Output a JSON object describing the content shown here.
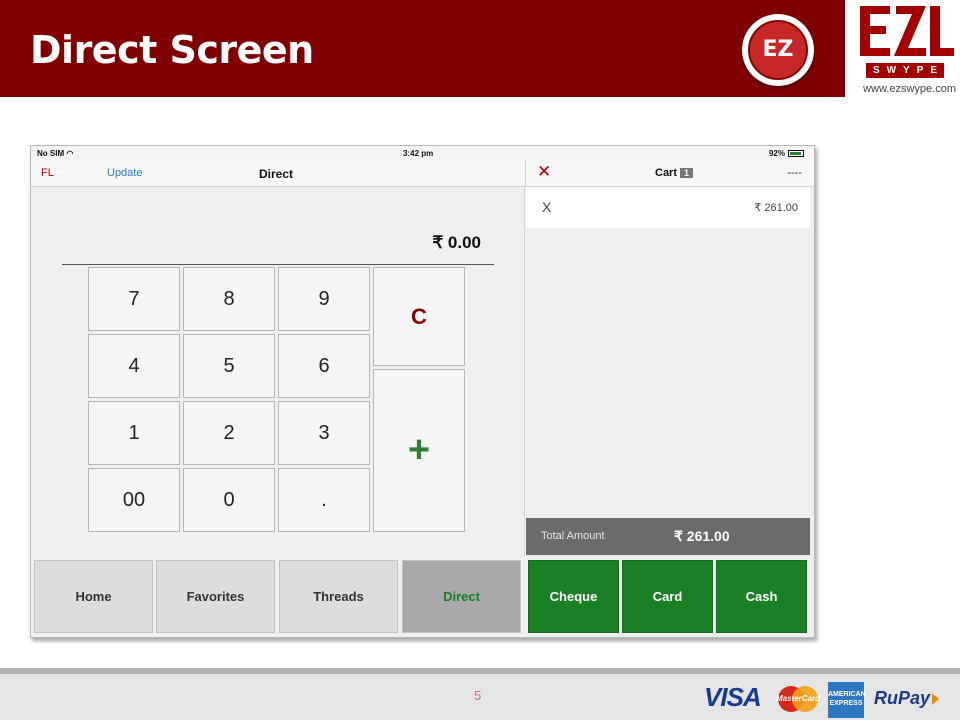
{
  "slide": {
    "title": "Direct Screen",
    "page_number": "5",
    "badge_text": "EZ"
  },
  "logo": {
    "swype": "SWYPE",
    "url": "www.ezswype.com"
  },
  "status_bar": {
    "carrier": "No SIM",
    "time": "3:42 pm",
    "battery": "92%"
  },
  "top_bar": {
    "fl": "FL",
    "update": "Update",
    "title": "Direct",
    "close_symbol": "✕",
    "cart_label": "Cart",
    "cart_count": "1",
    "dashes": "----"
  },
  "keypad": {
    "amount": "₹ 0.00",
    "keys": [
      "7",
      "8",
      "9",
      "4",
      "5",
      "6",
      "1",
      "2",
      "3",
      "00",
      "0",
      "."
    ],
    "clear": "C",
    "add": "+"
  },
  "cart": {
    "item_remove": "X",
    "item_price": "₹ 261.00",
    "total_label": "Total Amount",
    "total_value": "₹ 261.00"
  },
  "nav": {
    "home": "Home",
    "favorites": "Favorites",
    "threads": "Threads",
    "direct": "Direct"
  },
  "payment": {
    "cheque": "Cheque",
    "card": "Card",
    "cash": "Cash"
  },
  "footer_logos": {
    "visa": "VISA",
    "mastercard": "MasterCard",
    "amex": "AMERICAN EXPRESS",
    "rupay": "RuPay"
  },
  "colors": {
    "banner": "#800000",
    "accent_green": "#1a7f25",
    "accent_red": "#b00000"
  }
}
